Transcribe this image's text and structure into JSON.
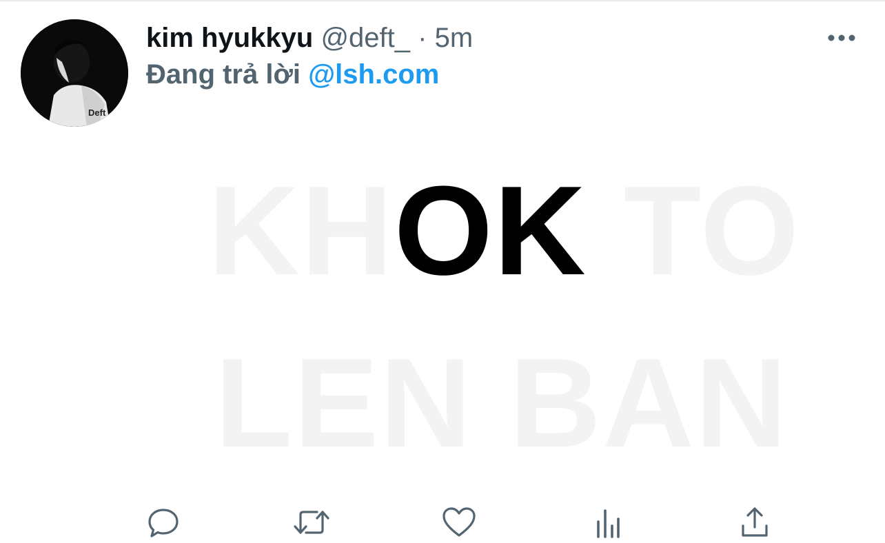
{
  "tweet": {
    "display_name": "kim hyukkyu",
    "handle": "@deft_",
    "separator": "·",
    "time": "5m",
    "reply_prefix": "Đang trả lời",
    "reply_mention": "@lsh.com",
    "avatar_label": "Deft"
  },
  "media": {
    "line1_pre": "KH",
    "line1_highlight": "OK",
    "line1_post": " TO",
    "line2": "LEN BAN"
  },
  "actions": {
    "reply_icon": "reply-icon",
    "retweet_icon": "retweet-icon",
    "like_icon": "heart-icon",
    "stats_icon": "analytics-icon",
    "share_icon": "share-icon"
  },
  "colors": {
    "accent": "#1d9bf0",
    "secondary_text": "#536471",
    "primary_text": "#0f1419",
    "faint_text": "#f3f3f3"
  }
}
